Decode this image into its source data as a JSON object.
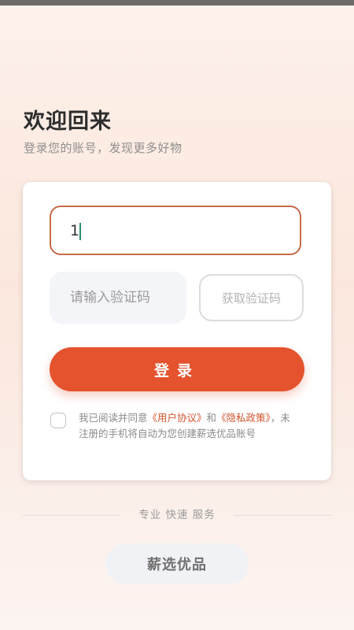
{
  "header": {
    "title": "欢迎回来",
    "subtitle": "登录您的账号，发现更多好物"
  },
  "login_form": {
    "phone_value": "1",
    "code_placeholder": "请输入验证码",
    "get_code_label": "获取验证码",
    "submit_label": "登录",
    "agreement": {
      "checked": false,
      "prefix": "我已阅读并同意",
      "user_agreement": "《用户协议》",
      "conjunction": "和",
      "privacy_policy": "《隐私政策》",
      "suffix": "，未注册的手机将自动为您创建薪选优品账号"
    }
  },
  "footer": {
    "tagline": "专业  快速  服务",
    "brand": "薪选优品"
  },
  "colors": {
    "accent": "#e4532e",
    "input_focus_border": "#c86a4a",
    "link": "#d1542f"
  }
}
